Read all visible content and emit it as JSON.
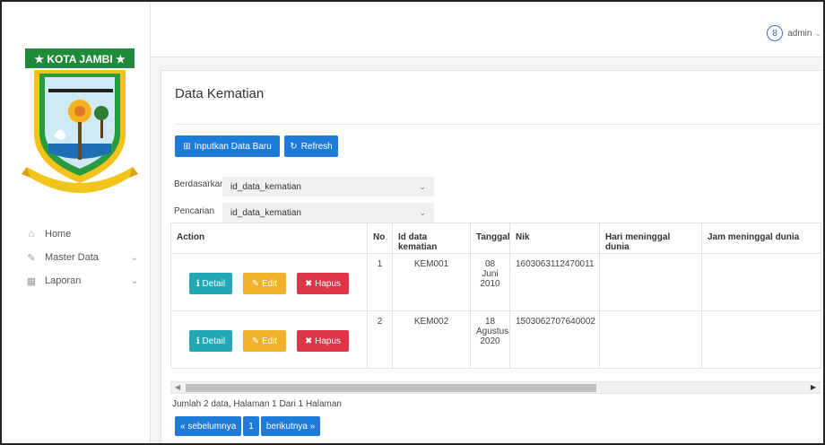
{
  "sidebar": {
    "logo_text": "★ KOTA JAMBI ★",
    "items": [
      {
        "label": "Home",
        "icon": "home-icon",
        "glyph": "⌂",
        "has_chevron": false
      },
      {
        "label": "Master Data",
        "icon": "edit-icon",
        "glyph": "✎",
        "has_chevron": true
      },
      {
        "label": "Laporan",
        "icon": "calendar-icon",
        "glyph": "▦",
        "has_chevron": true
      }
    ]
  },
  "topbar": {
    "user_name": "admin"
  },
  "card": {
    "title": "Data Kematian",
    "add_label": "Inputkan Data Baru",
    "refresh_label": "Refresh",
    "filter_label": "Berdasarkan",
    "filter_value": "id_data_kematian",
    "search_label": "Pencarian",
    "search_value": "id_data_kematian"
  },
  "table": {
    "headers": [
      "Action",
      "No",
      "Id data kematian",
      "Tanggal",
      "Nik",
      "Hari meninggal dunia",
      "Jam meninggal dunia"
    ],
    "action_labels": {
      "detail": "Detail",
      "edit": "Edit",
      "delete": "Hapus"
    },
    "rows": [
      {
        "no": "1",
        "id": "KEM001",
        "tanggal": "08 Juni 2010",
        "nik": "1603063112470011",
        "hari": "",
        "jam": ""
      },
      {
        "no": "2",
        "id": "KEM002",
        "tanggal": "18 Agustus 2020",
        "nik": "1503062707640002",
        "hari": "",
        "jam": ""
      }
    ]
  },
  "footer": {
    "info": "Jumlah 2 data, Halaman 1 Dari 1 Halaman",
    "prev": "« sebelumnya",
    "page": "1",
    "next": "berikutnya »"
  },
  "colors": {
    "primary": "#1e7bd8",
    "info": "#22a7b5",
    "warning": "#f0b22b",
    "danger": "#dc3545"
  }
}
